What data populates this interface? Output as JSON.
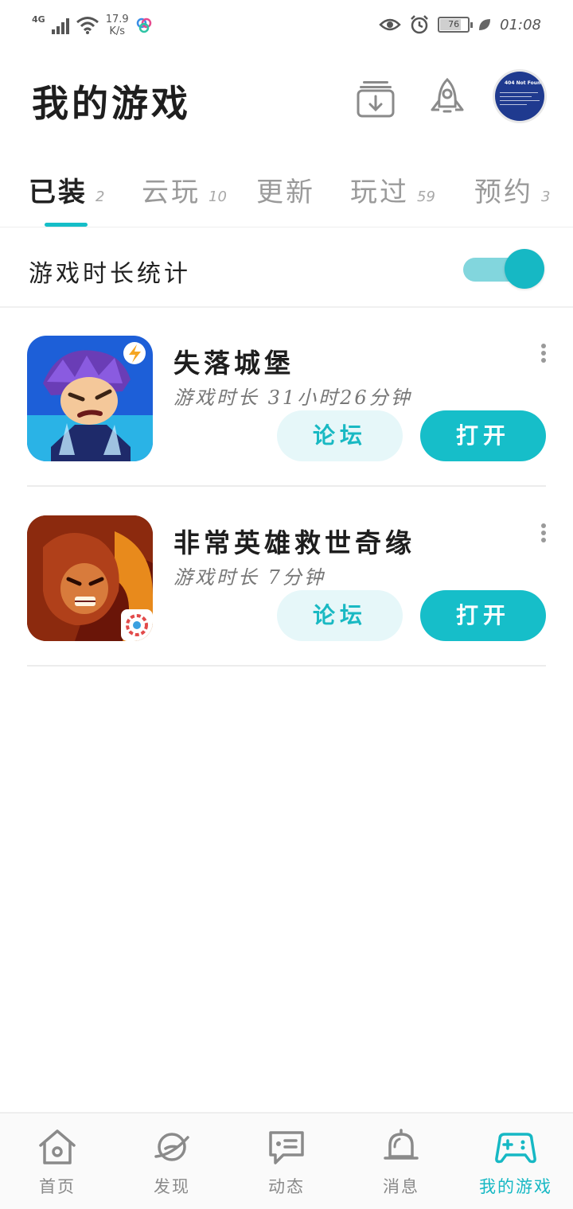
{
  "status_bar": {
    "network": "4G",
    "speed_value": "17.9",
    "speed_unit": "K/s",
    "battery": "76",
    "time": "01:08"
  },
  "header": {
    "title": "我的游戏",
    "download_icon": "download-tray-icon",
    "rocket_icon": "rocket-icon",
    "avatar_text": "404 Not Found"
  },
  "tabs": [
    {
      "label": "已装",
      "count": "2",
      "active": true
    },
    {
      "label": "云玩",
      "count": "10"
    },
    {
      "label": "更新",
      "count": ""
    },
    {
      "label": "玩过",
      "count": "59"
    },
    {
      "label": "预约",
      "count": "3"
    }
  ],
  "stats": {
    "label": "游戏时长统计",
    "toggle_on": true
  },
  "games": [
    {
      "name": "失落城堡",
      "playtime": "游戏时长 31小时26分钟",
      "forum_label": "论坛",
      "open_label": "打开"
    },
    {
      "name": "非常英雄救世奇缘",
      "playtime": "游戏时长 7分钟",
      "forum_label": "论坛",
      "open_label": "打开"
    }
  ],
  "bottom_nav": [
    {
      "label": "首页",
      "icon": "home-icon"
    },
    {
      "label": "发现",
      "icon": "planet-icon"
    },
    {
      "label": "动态",
      "icon": "chat-feed-icon"
    },
    {
      "label": "消息",
      "icon": "bell-icon"
    },
    {
      "label": "我的游戏",
      "icon": "gamepad-icon",
      "active": true
    }
  ],
  "colors": {
    "accent": "#16bec9",
    "accent_light": "#e6f7f9",
    "toggle_track": "#82d6dd"
  }
}
